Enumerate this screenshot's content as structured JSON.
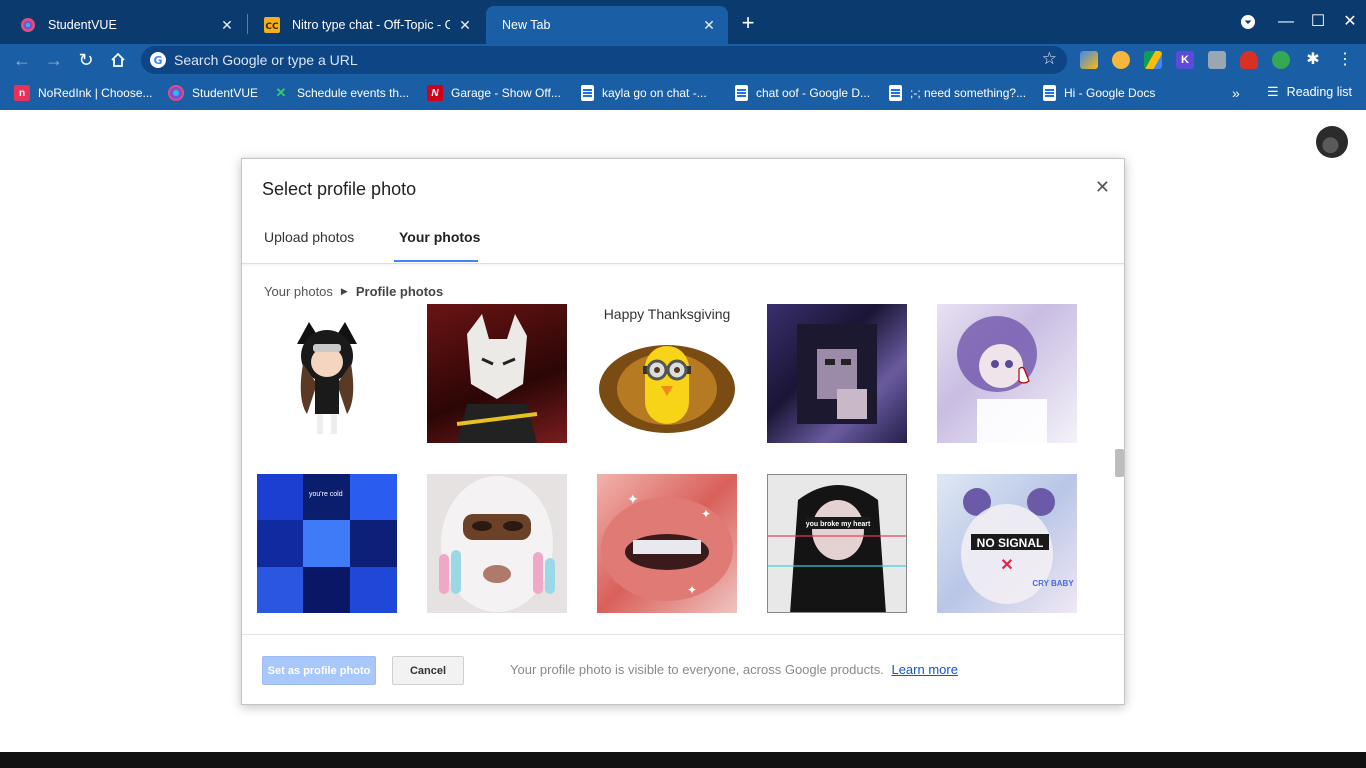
{
  "browser": {
    "tabs": [
      {
        "title": "StudentVUE",
        "active": false
      },
      {
        "title": "Nitro type chat - Off-Topic - Code",
        "active": false
      },
      {
        "title": "New Tab",
        "active": true
      }
    ],
    "omnibox_placeholder": "Search Google or type a URL",
    "bookmarks": [
      {
        "label": "NoRedInk | Choose..."
      },
      {
        "label": "StudentVUE"
      },
      {
        "label": "Schedule events th..."
      },
      {
        "label": "Garage - Show Off..."
      },
      {
        "label": "kayla go on chat -..."
      },
      {
        "label": "chat oof - Google D..."
      },
      {
        "label": ";-; need something?..."
      },
      {
        "label": "Hi - Google Docs"
      }
    ],
    "reading_list": "Reading list",
    "colors": {
      "frame": "#0b3a6e",
      "toolbar": "#1a5fa5",
      "omnibox": "#0d4585"
    }
  },
  "dialog": {
    "title": "Select profile photo",
    "tabs": [
      {
        "label": "Upload photos",
        "selected": false
      },
      {
        "label": "Your photos",
        "selected": true
      }
    ],
    "breadcrumb": {
      "root": "Your photos",
      "current": "Profile photos"
    },
    "photos": [
      {
        "icon": "chibi-cat-girl-avatar"
      },
      {
        "icon": "white-fox-anime-boy"
      },
      {
        "icon": "minion-turkey",
        "caption": "Happy Thanksgiving"
      },
      {
        "icon": "pixelated-portrait"
      },
      {
        "icon": "blurry-anime-girl"
      },
      {
        "icon": "blue-aesthetic-collage",
        "caption": "you're cold"
      },
      {
        "icon": "ski-mask-nails"
      },
      {
        "icon": "lips-with-grill"
      },
      {
        "icon": "glitch-girl",
        "caption": "you broke my heart"
      },
      {
        "icon": "no-signal-glitch",
        "caption": "NO SIGNAL",
        "caption2": "CRY BABY"
      }
    ],
    "set_button": "Set as profile photo",
    "cancel_button": "Cancel",
    "notice": "Your profile photo is visible to everyone, across Google products.",
    "learn_more": "Learn more",
    "accent": "#4285f4"
  }
}
